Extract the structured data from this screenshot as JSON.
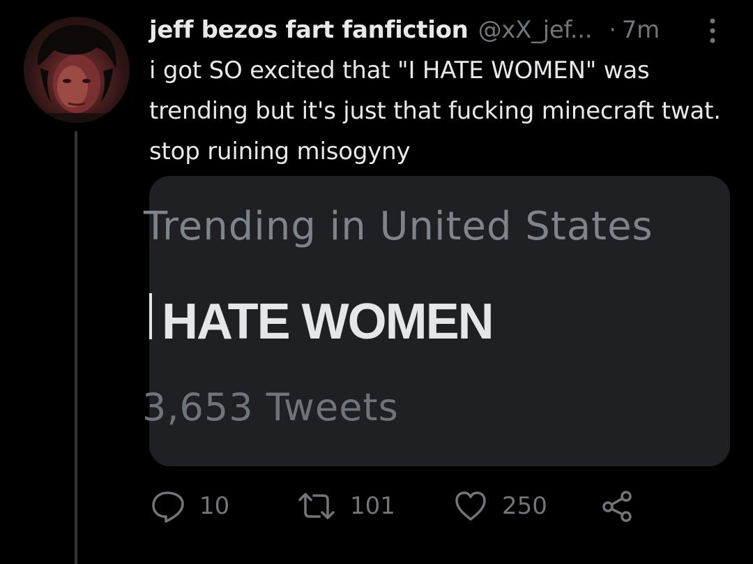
{
  "tweet": {
    "display_name": "jeff bezos fart fanfiction",
    "handle": "@xX_jef...",
    "separator": "·",
    "time": "7m",
    "text": "i got SO excited that \"I HATE WOMEN\" was trending but it's just that fucking minecraft twat. stop ruining misogyny",
    "avatar_icon": "profile-photo",
    "more_icon": "more-vertical-icon"
  },
  "media": {
    "heading": "Trending in United States",
    "trend": "HATE WOMEN",
    "count": "3,653 Tweets"
  },
  "actions": {
    "reply_count": "10",
    "retweet_count": "101",
    "like_count": "250",
    "reply_icon": "reply-icon",
    "retweet_icon": "retweet-icon",
    "like_icon": "heart-icon",
    "share_icon": "share-icon"
  },
  "colors": {
    "background": "#000000",
    "primary_text": "#e7e9ea",
    "secondary_text": "#71767b",
    "card_background": "#1e2023",
    "thread_line": "#333639"
  }
}
